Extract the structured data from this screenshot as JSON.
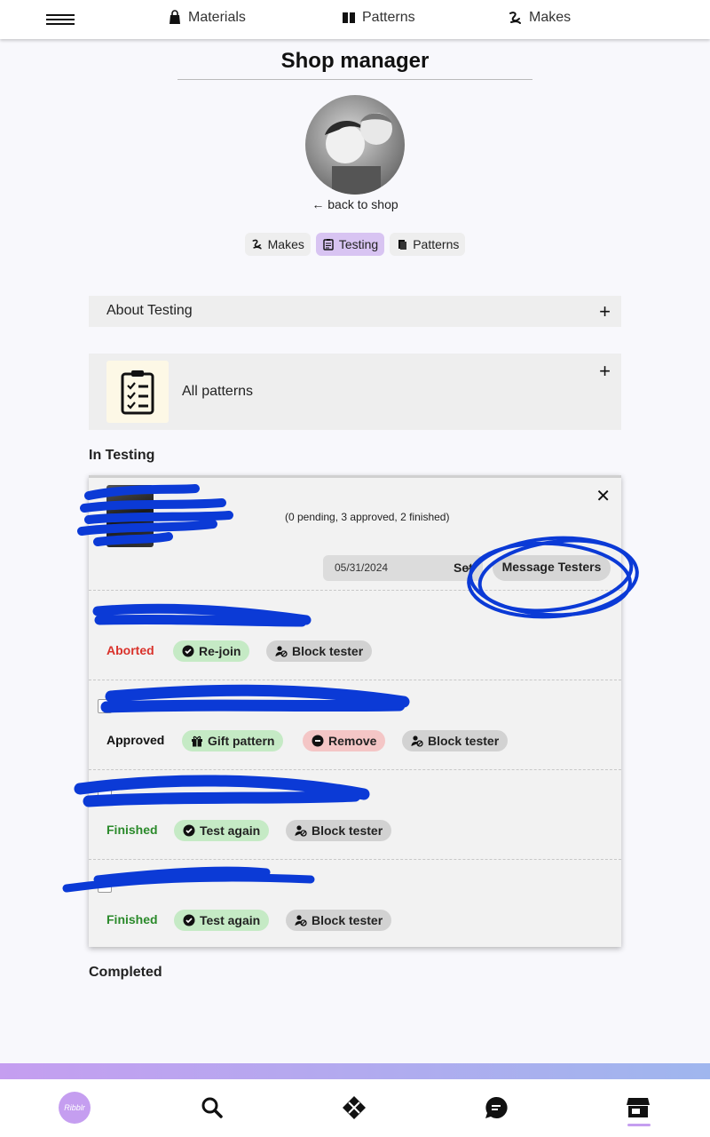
{
  "nav": {
    "materials": "Materials",
    "patterns": "Patterns",
    "makes": "Makes"
  },
  "page": {
    "title": "Shop manager",
    "back_link": "← back to shop"
  },
  "tabs": [
    {
      "label": "Makes",
      "icon": "makes-icon",
      "active": false
    },
    {
      "label": "Testing",
      "icon": "clipboard-icon",
      "active": true
    },
    {
      "label": "Patterns",
      "icon": "book-icon",
      "active": false
    }
  ],
  "about": {
    "label": "About Testing",
    "expand": "+"
  },
  "all_patterns": {
    "label": "All patterns",
    "expand": "+"
  },
  "in_testing": {
    "heading": "In Testing",
    "counts": "(0 pending, 3 approved, 2 finished)",
    "close": "✕",
    "date": "05/31/2024",
    "set_label": "Set",
    "message_label": "Message Testers",
    "rows": [
      {
        "status": "Aborted",
        "status_color": "#d9322b",
        "actions": [
          {
            "label": "Re-join",
            "style": "green"
          },
          {
            "label": "Block tester",
            "style": "grey"
          }
        ]
      },
      {
        "status": "Approved",
        "status_color": "#111111",
        "actions": [
          {
            "label": "Gift pattern",
            "style": "green"
          },
          {
            "label": "Remove",
            "style": "red"
          },
          {
            "label": "Block tester",
            "style": "grey"
          }
        ]
      },
      {
        "status": "Finished",
        "status_color": "#2b8a2b",
        "actions": [
          {
            "label": "Test again",
            "style": "green"
          },
          {
            "label": "Block tester",
            "style": "grey"
          }
        ]
      },
      {
        "status": "Finished",
        "status_color": "#2b8a2b",
        "actions": [
          {
            "label": "Test again",
            "style": "green"
          },
          {
            "label": "Block tester",
            "style": "grey"
          }
        ]
      }
    ]
  },
  "completed": {
    "heading": "Completed"
  },
  "bottom_nav": {
    "logo_text": "Ribblr",
    "items": [
      "home-logo",
      "search-icon",
      "pattern-icon",
      "chat-icon",
      "shop-icon"
    ]
  },
  "colors": {
    "accent": "#c59ef0",
    "scribble": "#0b3ad6"
  }
}
